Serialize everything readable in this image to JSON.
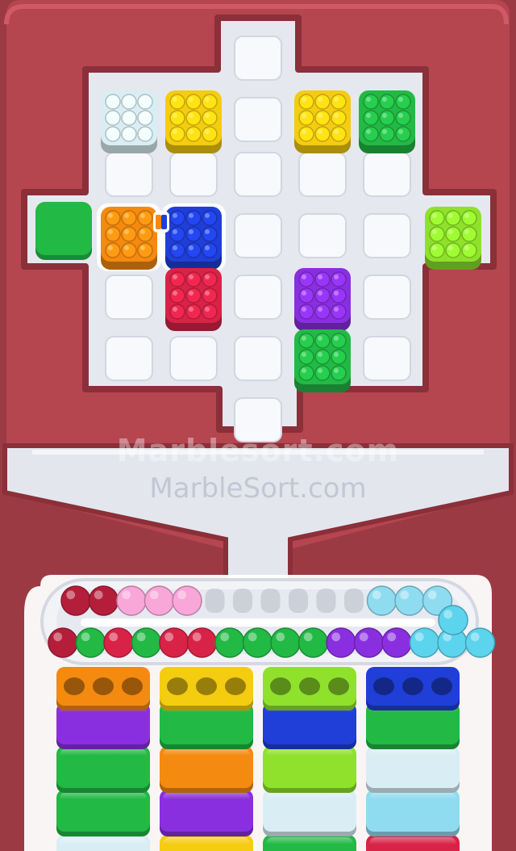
{
  "watermark": {
    "primary": "Marblesort.com",
    "secondary": "MarbleSort.com"
  },
  "colors": {
    "background": "#9c3a44",
    "frame": "#b5454f",
    "board": "#e8eaf0",
    "slot": "#f8f9fc",
    "white": "#d9eef4",
    "yellow": "#f4cc10",
    "green": "#22b945",
    "orange": "#f48a10",
    "blue": "#1f3fd8",
    "crimson": "#d82347",
    "purple": "#8a2fe0",
    "lime": "#8fe12c",
    "pink": "#f9a6d9",
    "maroon": "#b51e3b",
    "lightblue": "#8fdcf1",
    "cyan": "#5cd4ee"
  },
  "board": {
    "cols": 5,
    "rows": 6,
    "empty_slots": [
      [
        2,
        0
      ],
      [
        2,
        1
      ],
      [
        0,
        2
      ],
      [
        1,
        2
      ],
      [
        2,
        2
      ],
      [
        3,
        2
      ],
      [
        4,
        2
      ],
      [
        2,
        3
      ],
      [
        3,
        3
      ],
      [
        4,
        3
      ],
      [
        0,
        4
      ],
      [
        2,
        4
      ],
      [
        4,
        4
      ],
      [
        0,
        5
      ],
      [
        1,
        5
      ],
      [
        2,
        5
      ],
      [
        4,
        5
      ],
      [
        2,
        6
      ]
    ],
    "boxes": [
      {
        "color": "white",
        "col": 0,
        "row": 1
      },
      {
        "color": "yellow",
        "col": 1,
        "row": 1
      },
      {
        "color": "yellow",
        "col": 3,
        "row": 1
      },
      {
        "color": "green",
        "col": 4,
        "row": 1
      },
      {
        "color": "orange",
        "col": 0,
        "row": 3,
        "selected": true
      },
      {
        "color": "blue",
        "col": 1,
        "row": 3,
        "selected": true
      },
      {
        "color": "crimson",
        "col": 1,
        "row": 4
      },
      {
        "color": "purple",
        "col": 3,
        "row": 4
      },
      {
        "color": "green",
        "col": 3,
        "row": 5
      },
      {
        "color": "lime",
        "col": 5,
        "row": 3
      }
    ],
    "side_block": {
      "color": "green"
    }
  },
  "conveyor": {
    "top_lane": [
      "maroon",
      "maroon",
      "pink",
      "pink",
      "pink",
      "empty",
      "empty",
      "empty",
      "empty",
      "empty",
      "empty",
      "lightblue",
      "lightblue",
      "lightblue"
    ],
    "bottom_lane": [
      "maroon",
      "green",
      "crimson",
      "green",
      "crimson",
      "crimson",
      "green",
      "green",
      "green",
      "green",
      "purple",
      "purple",
      "purple",
      "cyan",
      "cyan",
      "cyan"
    ]
  },
  "stacks": [
    {
      "top": "orange",
      "holes_filled": 0,
      "layers": [
        "purple",
        "green",
        "green",
        "white"
      ]
    },
    {
      "top": "yellow",
      "holes_filled": 0,
      "layers": [
        "green",
        "orange",
        "purple",
        "yellow"
      ]
    },
    {
      "top": "lime",
      "holes_filled": 0,
      "layers": [
        "blue",
        "lime",
        "white",
        "green"
      ]
    },
    {
      "top": "blue",
      "holes_filled": 0,
      "layers": [
        "green",
        "white",
        "lightblue",
        "crimson"
      ]
    }
  ]
}
